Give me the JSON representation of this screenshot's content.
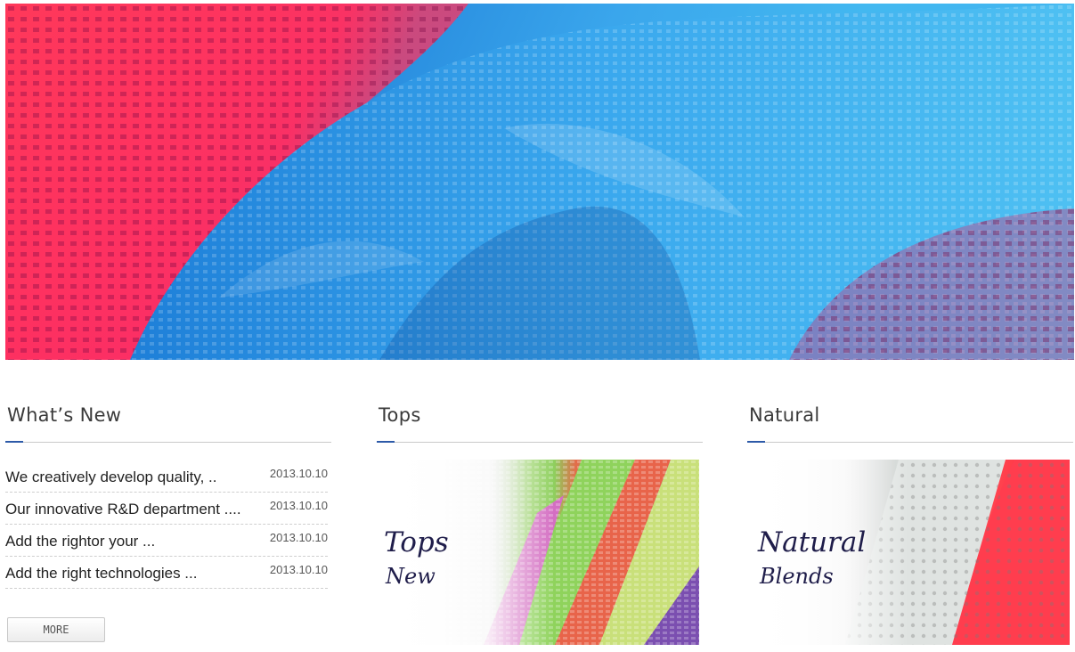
{
  "hero": {
    "image": "lace-fabric-banner",
    "colors": {
      "pink": "#f52a6e",
      "blue": "#2a8fe0",
      "light_blue": "#43b8f0"
    }
  },
  "columns": [
    {
      "title": "What’s New"
    },
    {
      "title": "Tops"
    },
    {
      "title": "Natural"
    }
  ],
  "news": {
    "items": [
      {
        "title": "We creatively develop quality, ..",
        "date": "2013.10.10"
      },
      {
        "title": "Our innovative R&D department ....",
        "date": "2013.10.10"
      },
      {
        "title": "Add the rightor your ...",
        "date": "2013.10.10"
      },
      {
        "title": "Add the right technologies ...",
        "date": "2013.10.10"
      }
    ],
    "more_label": "MORE"
  },
  "features": {
    "tops": {
      "line1": "Tops",
      "line2": "New"
    },
    "natural": {
      "line1": "Natural",
      "line2": "Blends"
    }
  },
  "theme": {
    "accent": "#2d5aa8",
    "caption_color": "#1f1d4a"
  }
}
